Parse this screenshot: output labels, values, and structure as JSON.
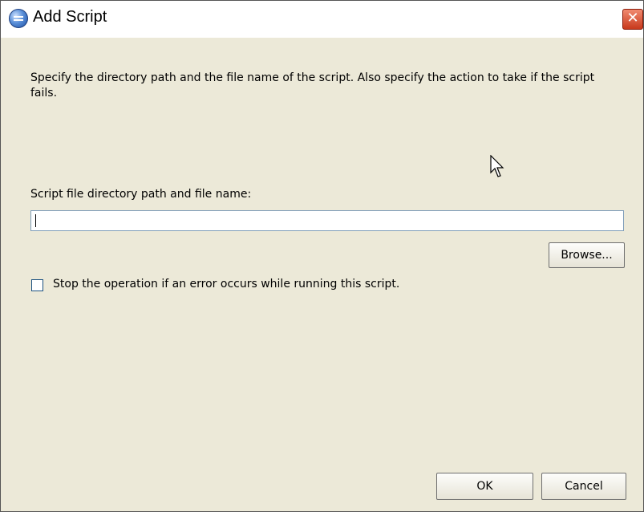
{
  "window": {
    "title": "Add Script",
    "title_icon": "eclipse-dialog-icon",
    "close_symbol": "✕"
  },
  "content": {
    "description": "Specify the directory path and the file name of the script. Also specify the action to take if the script fails.",
    "field_label": "Script file directory path and file name:",
    "path_value": "",
    "browse_label": "Browse...",
    "checkbox_label": "Stop the operation if an error occurs while running this script.",
    "checkbox_checked": false
  },
  "buttons": {
    "ok_label": "OK",
    "cancel_label": "Cancel"
  },
  "colors": {
    "dialog_bg": "#ece9d8",
    "close_red": "#c8391c",
    "input_border": "#7f9db9"
  }
}
